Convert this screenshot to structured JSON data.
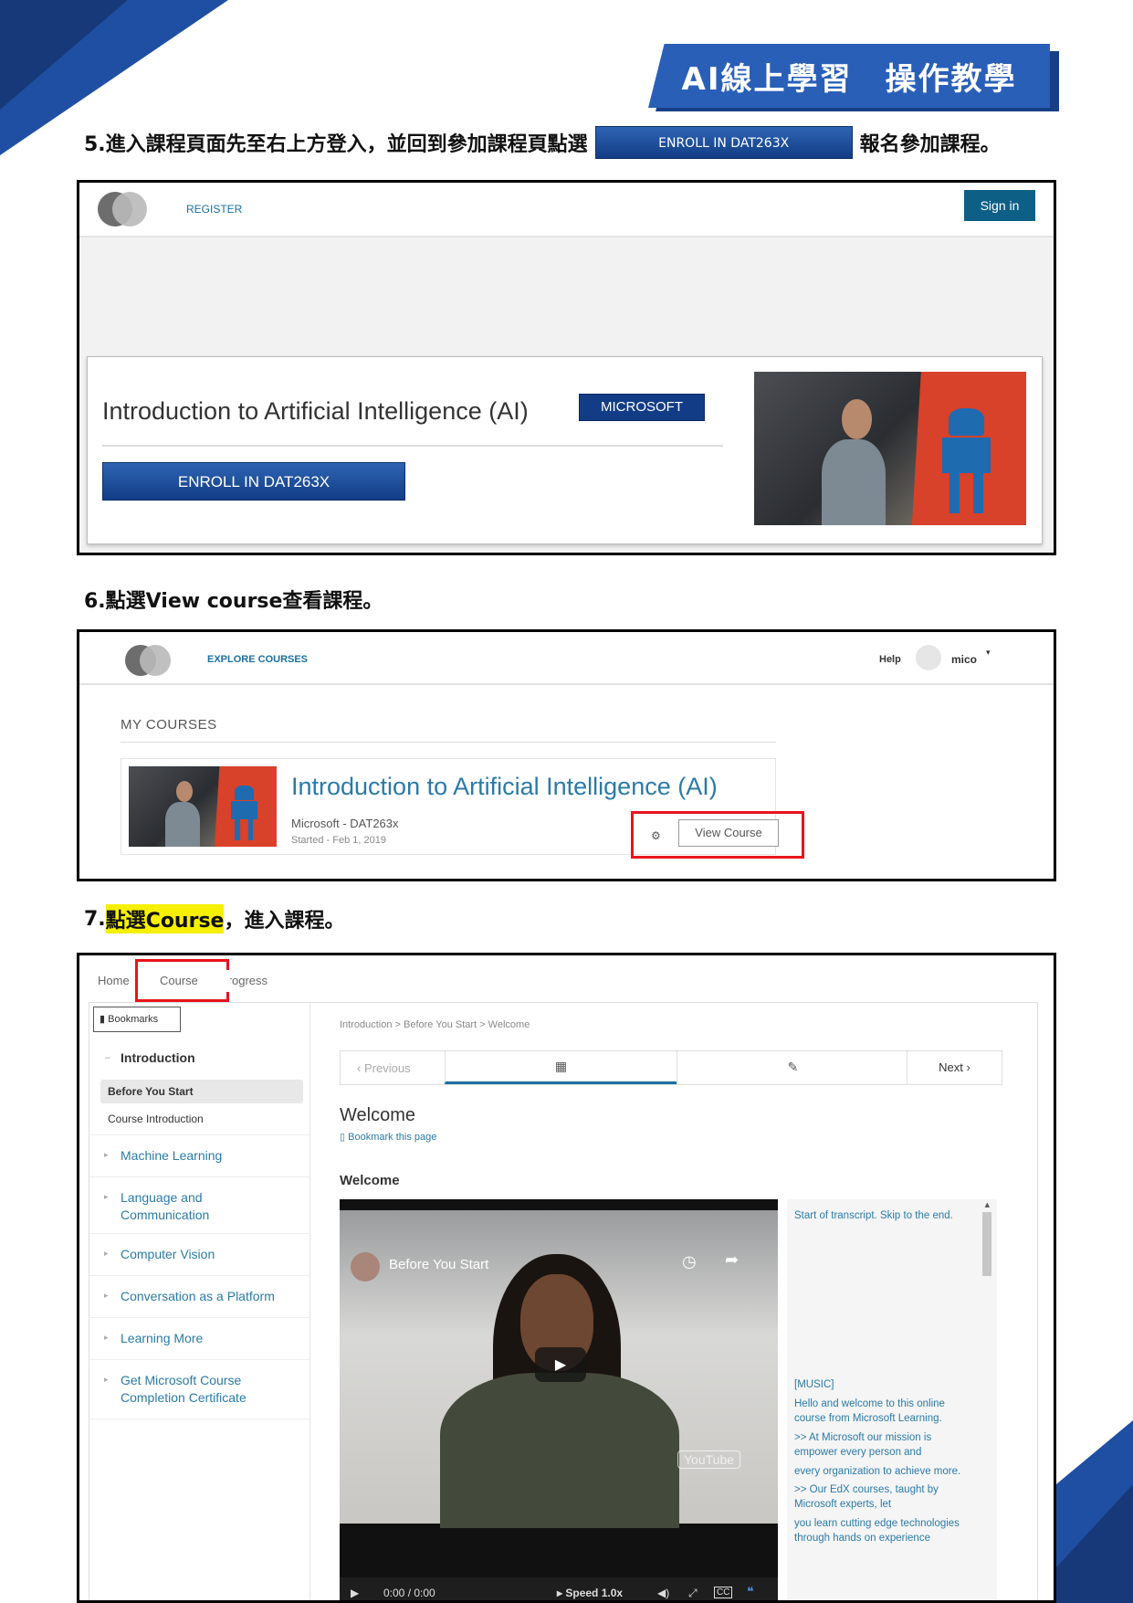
{
  "banner": {
    "title": "AI線上學習　操作教學"
  },
  "step5": {
    "text_before": "5.進入課程頁面先至右上方登入，並回到參加課程頁點選",
    "button": "ENROLL IN DAT263X",
    "text_after": "報名參加課程。"
  },
  "step6": {
    "text": "6.點選View  course查看課程。"
  },
  "step7": {
    "prefix": "7.",
    "highlight": "點選Course",
    "suffix": "，進入課程。"
  },
  "panel1": {
    "register": "REGISTER",
    "sign_in": "Sign in",
    "course_title": "Introduction to Artificial Intelligence (AI)",
    "org_badge": "MICROSOFT",
    "enroll": "ENROLL IN DAT263X"
  },
  "panel2": {
    "explore": "EXPLORE COURSES",
    "help": "Help",
    "username": "mico",
    "caret": "▾",
    "my_courses": "MY COURSES",
    "course_title": "Introduction to Artificial Intelligence (AI)",
    "org": "Microsoft - DAT263x",
    "started": "Started - Feb 1, 2019",
    "gear": "⚙",
    "view_course": "View Course"
  },
  "panel3": {
    "tabs": [
      "Home",
      "Course",
      "Progress"
    ],
    "bookmarks": "Bookmarks",
    "bookmark_glyph": "▮",
    "intro_section": "Introduction",
    "intro_chev": "−",
    "sub_active": "Before You Start",
    "sub_other": "Course Introduction",
    "sections": [
      "Machine Learning",
      "Language and Communication",
      "Computer Vision",
      "Conversation as a Platform",
      "Learning More",
      "Get Microsoft Course Completion Certificate"
    ],
    "section_chev": "▸",
    "breadcrumb": "Introduction > Before You Start > Welcome",
    "prev": "Previous",
    "prev_glyph": "‹",
    "next": "Next",
    "next_glyph": "›",
    "video_tab_glyph": "▦",
    "edit_tab_glyph": "✎",
    "unit_title": "Welcome",
    "bookmark_page": "Bookmark this page",
    "bookmark_page_glyph": "▯",
    "video_heading": "Welcome",
    "video_channel_title": "Before You Start",
    "clock_glyph": "◷",
    "share_glyph": "➦",
    "play_glyph": "▶",
    "youtube": "YouTube",
    "controls": {
      "play": "▶",
      "time": "0:00 / 0:00",
      "speed": "▸ Speed 1.0x",
      "volume": "◀)",
      "fullscreen": "⤢",
      "cc": "CC",
      "quote": "❝"
    },
    "transcript": [
      "Start of transcript. Skip to the end.",
      "[MUSIC]",
      "Hello and welcome to this online course from Microsoft Learning.",
      ">> At Microsoft our mission is empower every person and",
      "every organization to achieve more.",
      ">> Our EdX courses, taught by Microsoft experts, let",
      "you learn cutting edge technologies through hands on experience"
    ],
    "scroll_up": "▲",
    "scroll_down": "▼"
  }
}
